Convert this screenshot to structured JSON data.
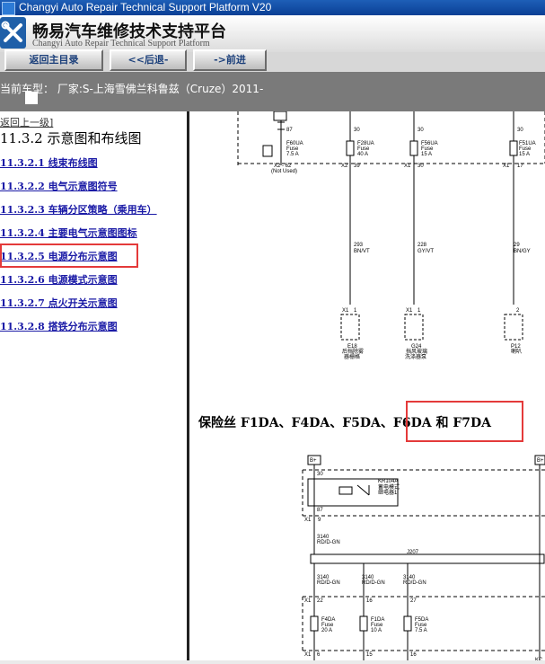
{
  "window": {
    "title": "Changyi Auto Repair Technical Support Platform V20"
  },
  "header": {
    "app_name": "畅易汽车维修技术支持平台",
    "app_subtitle": "Changyi Auto Repair Technical Support Platform"
  },
  "toolbar": {
    "buttons": [
      {
        "label": "返回主目录"
      },
      {
        "label": "<<后退-"
      },
      {
        "label": "->前进"
      }
    ]
  },
  "info": {
    "vehicle_text": "当前车型： 厂家:S-上海雪佛兰科鲁兹（Cruze）2011-"
  },
  "sidebar": {
    "back_link": "返回上一级]",
    "section_title": "11.3.2 示意图和布线图",
    "items": [
      {
        "label": "11.3.2.1 线束布线图"
      },
      {
        "label": "11.3.2.2 电气示意图符号"
      },
      {
        "label": "11.3.2.3 车辆分区策略（乘用车）"
      },
      {
        "label": "11.3.2.4 主要电气示意图图标"
      },
      {
        "label": "11.3.2.5 电源分布示意图"
      },
      {
        "label": "11.3.2.6 电源模式示意图"
      },
      {
        "label": "11.3.2.7 点火开关示意图"
      },
      {
        "label": "11.3.2.8 搭铁分布示意图"
      }
    ]
  },
  "content": {
    "fuse_heading": "保险丝 F1DA、F4DA、F5DA、F6DA 和 F7DA",
    "top_diagram": {
      "pins_top": [
        "87",
        "30",
        "30",
        "30"
      ],
      "fuses": [
        {
          "name": "F60UA",
          "type": "Fuse",
          "rating": "7.5 A"
        },
        {
          "name": "F28UA",
          "type": "Fuse",
          "rating": "40 A"
        },
        {
          "name": "F56UA",
          "type": "Fuse",
          "rating": "15 A"
        },
        {
          "name": "F51UA",
          "type": "Fuse",
          "rating": "15 A"
        }
      ],
      "connectors": [
        "X2 - 62",
        "X2",
        "39",
        "X1",
        "30",
        "X1",
        "17"
      ],
      "not_used": "(Not Used)",
      "wires": [
        {
          "circuit": "293",
          "color": "BN/VT"
        },
        {
          "circuit": "228",
          "color": "GY/VT"
        },
        {
          "circuit": "29",
          "color": "BN/GY"
        }
      ],
      "lower_pins": [
        "X1",
        "1",
        "X1",
        "1",
        "2"
      ],
      "components": [
        {
          "id": "E18",
          "desc1": "后挡除雾",
          "desc2": "器栅格"
        },
        {
          "id": "G24",
          "desc1": "挡风玻璃",
          "desc2": "洗涤器泵"
        },
        {
          "id": "P12",
          "desc1": "喇叭",
          "desc2": ""
        }
      ]
    },
    "bottom_diagram": {
      "battery": "B+",
      "relay_id": "KR104A",
      "relay_desc1": "蓄电模式",
      "relay_desc2": "继电器1",
      "pins": [
        "30",
        "87",
        "9"
      ],
      "connector_x1": "X1",
      "wire_main": {
        "circuit": "3140",
        "color": "RD/D-GN"
      },
      "splice": "J207",
      "branch_wires": [
        {
          "circuit": "3140",
          "color": "RD/D-GN"
        },
        {
          "circuit": "3140",
          "color": "RD/D-GN"
        },
        {
          "circuit": "3140",
          "color": "RD/D-GN"
        }
      ],
      "branch_pins": [
        "22",
        "16",
        "27"
      ],
      "fuses": [
        {
          "name": "F4DA",
          "type": "Fuse",
          "rating": "20 A"
        },
        {
          "name": "F1DA",
          "type": "Fuse",
          "rating": "10 A"
        },
        {
          "name": "F5DA",
          "type": "Fuse",
          "rating": "7.5 A"
        }
      ],
      "lower_pins": [
        "X1",
        "6",
        "15",
        "16"
      ],
      "right_label": "KC"
    }
  }
}
